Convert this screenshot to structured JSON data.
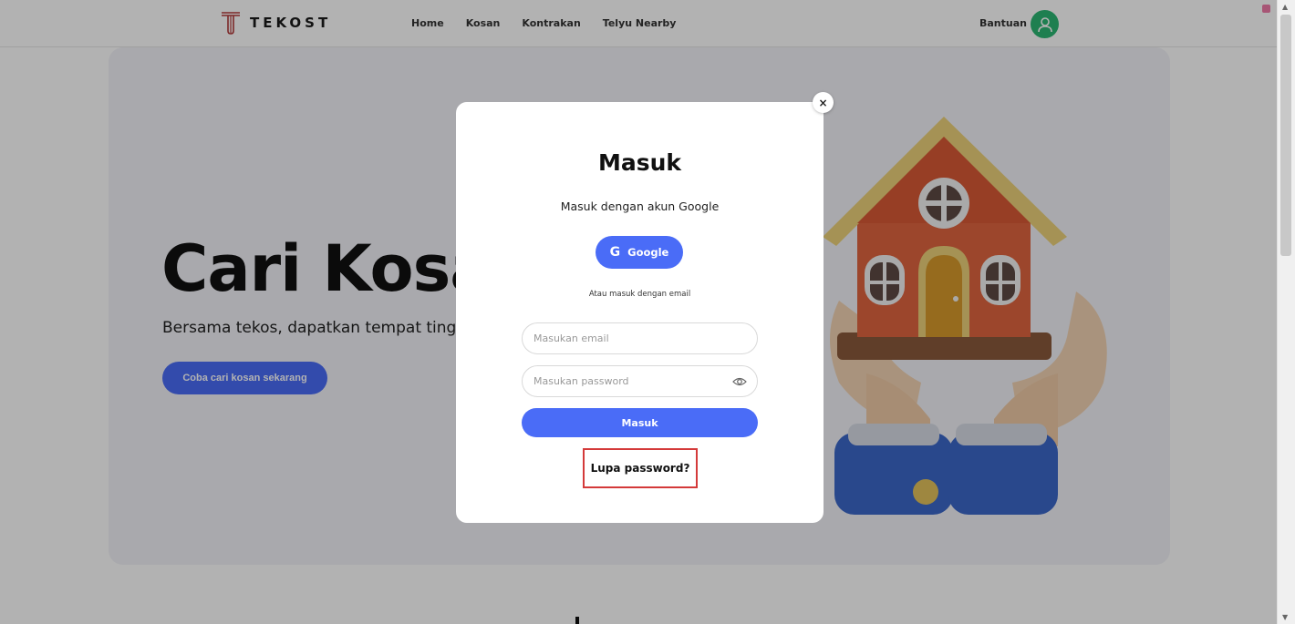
{
  "navbar": {
    "brand": "TEKOST",
    "links": [
      "Home",
      "Kosan",
      "Kontrakan",
      "Telyu Nearby"
    ],
    "help": "Bantuan"
  },
  "hero": {
    "title": "Cari Kosan",
    "subtitle": "Bersama tekos, dapatkan tempat tinggal",
    "cta": "Coba cari kosan sekarang"
  },
  "modal": {
    "title": "Masuk",
    "google_prompt": "Masuk dengan akun Google",
    "google_button": "Google",
    "google_glyph": "G",
    "email_prompt": "Atau masuk dengan email",
    "email_placeholder": "Masukan email",
    "password_placeholder": "Masukan password",
    "submit": "Masuk",
    "forgot": "Lupa password?",
    "close_glyph": "×"
  },
  "colors": {
    "accent": "#4a6cf7",
    "avatar": "#2bb673",
    "highlight_border": "#d43a3a"
  }
}
